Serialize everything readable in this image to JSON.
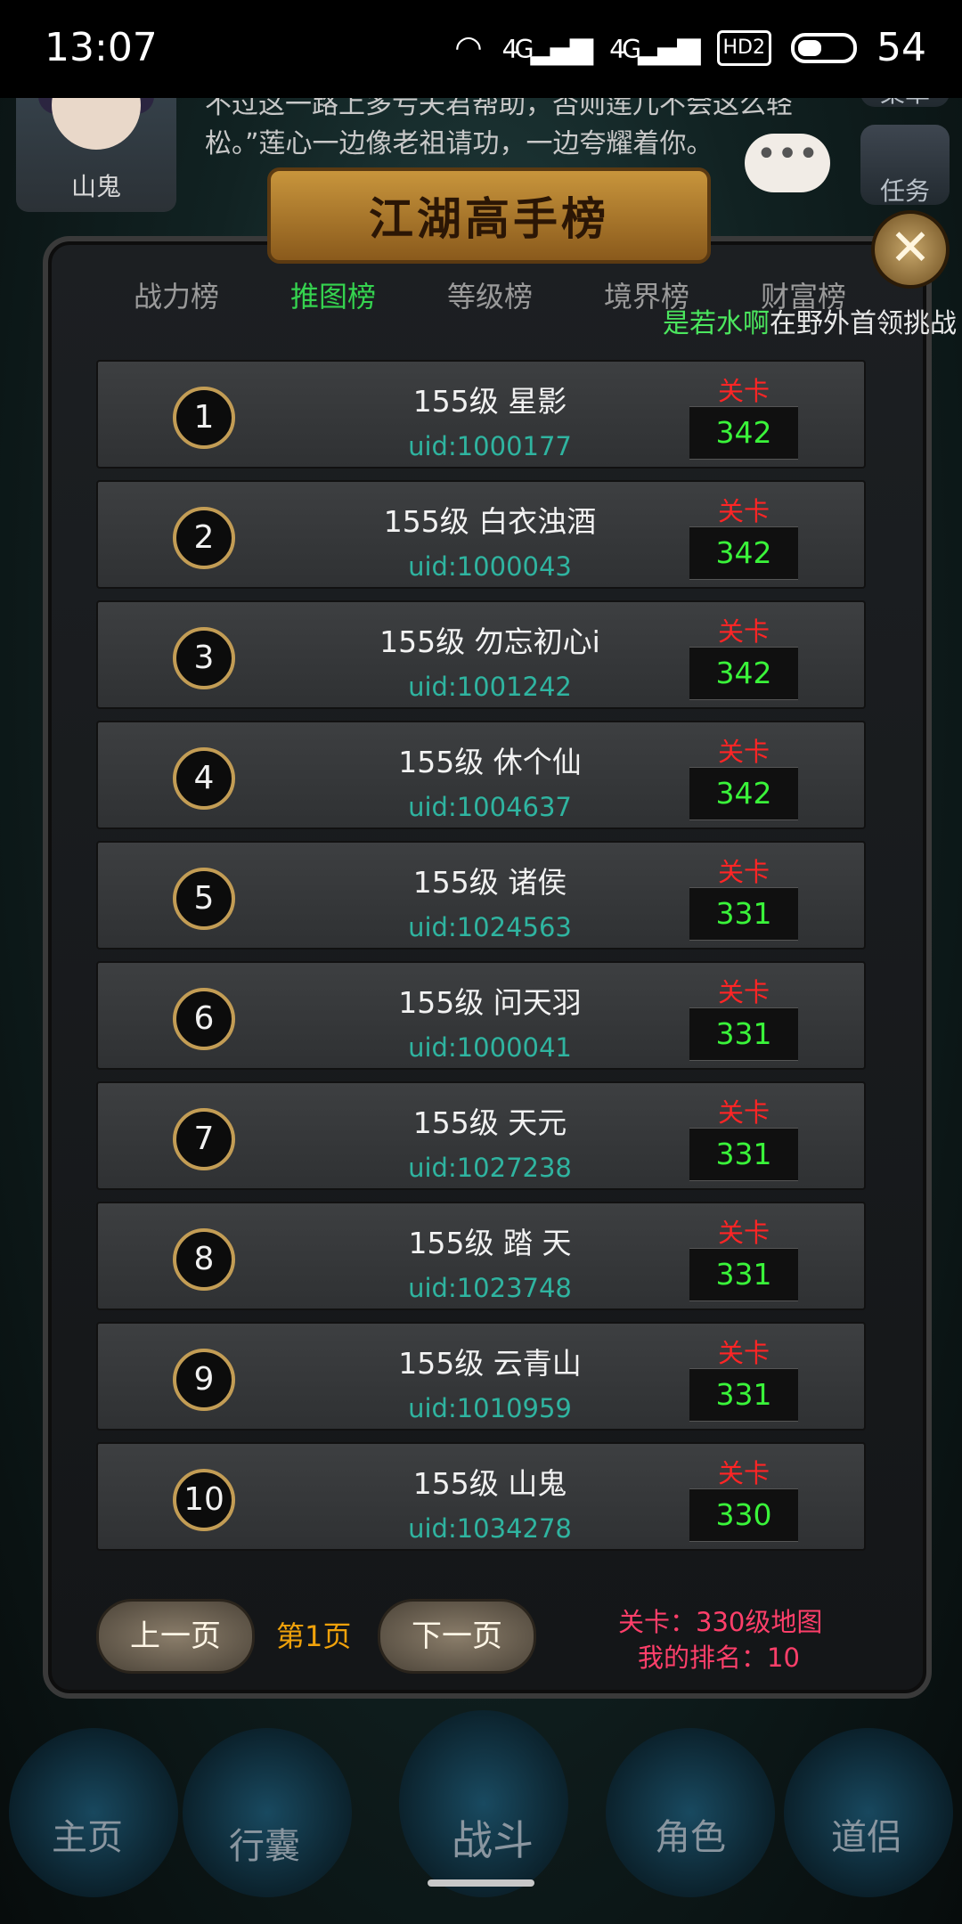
{
  "status_bar": {
    "time": "13:07",
    "signal1": "4G",
    "signal2": "4G",
    "hd": "HD2",
    "battery": "54"
  },
  "background": {
    "avatar_name": "山鬼",
    "dialog": "“老祖，莲儿不负重托，成功莲花第一位的奇异物体。不过这一路上多亏夫君帮助，否则莲儿不会这么轻松。”莲心一边像老祖请功，一边夸耀着你。",
    "side_menu": "菜单",
    "side_task": "任务"
  },
  "panel": {
    "title": "江湖高手榜",
    "close": "✕",
    "tabs": [
      "战力榜",
      "推图榜",
      "等级榜",
      "境界榜",
      "财富榜"
    ],
    "active_tab": 1,
    "marquee_name": "是若水啊",
    "marquee_text": "在野外首领挑战",
    "stage_label": "关卡",
    "rows": [
      {
        "rank": "1",
        "name": "155级 星影",
        "uid": "uid:1000177",
        "stage": "342"
      },
      {
        "rank": "2",
        "name": "155级 白衣浊酒",
        "uid": "uid:1000043",
        "stage": "342"
      },
      {
        "rank": "3",
        "name": "155级 勿忘初心i",
        "uid": "uid:1001242",
        "stage": "342"
      },
      {
        "rank": "4",
        "name": "155级 休个仙",
        "uid": "uid:1004637",
        "stage": "342"
      },
      {
        "rank": "5",
        "name": "155级 诸侯",
        "uid": "uid:1024563",
        "stage": "331"
      },
      {
        "rank": "6",
        "name": "155级 问天羽",
        "uid": "uid:1000041",
        "stage": "331"
      },
      {
        "rank": "7",
        "name": "155级 天元",
        "uid": "uid:1027238",
        "stage": "331"
      },
      {
        "rank": "8",
        "name": "155级 踏 天",
        "uid": "uid:1023748",
        "stage": "331"
      },
      {
        "rank": "9",
        "name": "155级 云青山",
        "uid": "uid:1010959",
        "stage": "331"
      },
      {
        "rank": "10",
        "name": "155级 山鬼",
        "uid": "uid:1034278",
        "stage": "330"
      }
    ],
    "prev_page": "上一页",
    "page_indicator": "第1页",
    "next_page": "下一页",
    "my_stage": "关卡：330级地图",
    "my_rank": "我的排名：10"
  },
  "bottom_nav": [
    "主页",
    "行囊",
    "战斗",
    "角色",
    "道侣"
  ],
  "colors": {
    "accent_green": "#35d34f",
    "stage_red": "#ff2525",
    "stage_value": "#3af43a",
    "uid_teal": "#2fb4a0",
    "page_orange": "#f0a20b",
    "rank_pink": "#ff3f6a"
  }
}
